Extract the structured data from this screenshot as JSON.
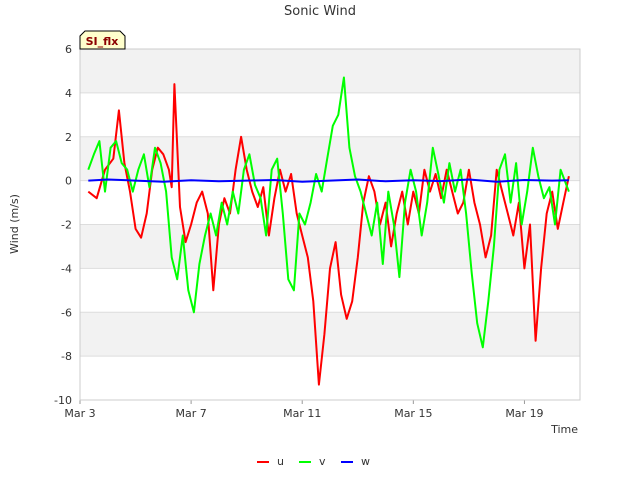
{
  "chart_data": {
    "type": "line",
    "title": "Sonic Wind",
    "xlabel": "Time",
    "ylabel": "Wind (m/s)",
    "badge": "SI_flx",
    "ylim": [
      -10,
      6
    ],
    "yticks": [
      -10,
      -8,
      -6,
      -4,
      -2,
      0,
      2,
      4,
      6
    ],
    "xlim": [
      0,
      18
    ],
    "xticks": [
      {
        "value": 0,
        "label": "Mar 3"
      },
      {
        "value": 4,
        "label": "Mar 7"
      },
      {
        "value": 8,
        "label": "Mar 11"
      },
      {
        "value": 12,
        "label": "Mar 15"
      },
      {
        "value": 16,
        "label": "Mar 19"
      }
    ],
    "grid": true,
    "legend_position": "bottom-center",
    "series": [
      {
        "name": "u",
        "color": "#ff0000",
        "x": [
          0.3,
          0.6,
          0.9,
          1.2,
          1.4,
          1.6,
          1.8,
          2.0,
          2.2,
          2.4,
          2.6,
          2.8,
          3.0,
          3.2,
          3.3,
          3.4,
          3.6,
          3.8,
          4.0,
          4.2,
          4.4,
          4.6,
          4.8,
          5.0,
          5.2,
          5.4,
          5.6,
          5.8,
          6.0,
          6.2,
          6.4,
          6.6,
          6.8,
          7.0,
          7.2,
          7.4,
          7.6,
          7.8,
          8.0,
          8.2,
          8.4,
          8.6,
          8.8,
          9.0,
          9.2,
          9.4,
          9.6,
          9.8,
          10.0,
          10.2,
          10.4,
          10.6,
          10.8,
          11.0,
          11.2,
          11.4,
          11.6,
          11.8,
          12.0,
          12.2,
          12.4,
          12.6,
          12.8,
          13.0,
          13.2,
          13.4,
          13.6,
          13.8,
          14.0,
          14.2,
          14.4,
          14.6,
          14.8,
          15.0,
          15.2,
          15.4,
          15.6,
          15.8,
          16.0,
          16.2,
          16.4,
          16.6,
          16.8,
          17.0,
          17.2,
          17.4,
          17.6
        ],
        "values": [
          -0.5,
          -0.8,
          0.5,
          1.0,
          3.2,
          0.8,
          -0.5,
          -2.2,
          -2.6,
          -1.5,
          0.5,
          1.5,
          1.2,
          0.5,
          -0.3,
          4.4,
          -1.2,
          -2.8,
          -2.0,
          -1.0,
          -0.5,
          -1.5,
          -5.0,
          -2.0,
          -0.8,
          -1.5,
          0.5,
          2.0,
          0.5,
          -0.5,
          -1.2,
          -0.3,
          -2.5,
          -0.8,
          0.5,
          -0.5,
          0.3,
          -1.5,
          -2.5,
          -3.5,
          -5.5,
          -9.3,
          -7.0,
          -4.0,
          -2.8,
          -5.2,
          -6.3,
          -5.5,
          -3.5,
          -1.0,
          0.2,
          -0.5,
          -2.0,
          -1.0,
          -3.0,
          -1.5,
          -0.5,
          -2.0,
          -0.5,
          -1.5,
          0.5,
          -0.5,
          0.3,
          -0.8,
          0.5,
          -0.5,
          -1.5,
          -1.0,
          0.5,
          -1.0,
          -2.0,
          -3.5,
          -2.5,
          0.5,
          -0.5,
          -1.5,
          -2.5,
          -1.0,
          -4.0,
          -2.0,
          -7.3,
          -4.0,
          -1.5,
          -0.5,
          -2.2,
          -1.0,
          0.2
        ]
      },
      {
        "name": "v",
        "color": "#00ff00",
        "x": [
          0.3,
          0.5,
          0.7,
          0.9,
          1.1,
          1.3,
          1.5,
          1.7,
          1.9,
          2.1,
          2.3,
          2.5,
          2.7,
          2.9,
          3.1,
          3.3,
          3.5,
          3.7,
          3.9,
          4.1,
          4.3,
          4.5,
          4.7,
          4.9,
          5.1,
          5.3,
          5.5,
          5.7,
          5.9,
          6.1,
          6.3,
          6.5,
          6.7,
          6.9,
          7.1,
          7.3,
          7.5,
          7.7,
          7.9,
          8.1,
          8.3,
          8.5,
          8.7,
          8.9,
          9.1,
          9.3,
          9.5,
          9.7,
          9.9,
          10.1,
          10.3,
          10.5,
          10.7,
          10.9,
          11.1,
          11.3,
          11.5,
          11.7,
          11.9,
          12.1,
          12.3,
          12.5,
          12.7,
          12.9,
          13.1,
          13.3,
          13.5,
          13.7,
          13.9,
          14.1,
          14.3,
          14.5,
          14.7,
          14.9,
          15.1,
          15.3,
          15.5,
          15.7,
          15.9,
          16.1,
          16.3,
          16.5,
          16.7,
          16.9,
          17.1,
          17.3,
          17.6
        ],
        "values": [
          0.5,
          1.2,
          1.8,
          -0.5,
          1.5,
          1.8,
          0.8,
          0.5,
          -0.5,
          0.5,
          1.2,
          -0.3,
          1.5,
          0.8,
          -0.5,
          -3.5,
          -4.5,
          -2.5,
          -5.0,
          -6.0,
          -3.8,
          -2.5,
          -1.5,
          -2.5,
          -1.0,
          -2.0,
          -0.5,
          -1.5,
          0.5,
          1.2,
          -0.2,
          -0.8,
          -2.5,
          0.5,
          1.0,
          -1.5,
          -4.5,
          -5.0,
          -1.5,
          -2.0,
          -1.0,
          0.3,
          -0.5,
          1.0,
          2.5,
          3.0,
          4.7,
          1.5,
          0.2,
          -0.5,
          -1.5,
          -2.5,
          -1.0,
          -3.8,
          -0.5,
          -2.0,
          -4.4,
          -1.0,
          0.5,
          -0.5,
          -2.5,
          -1.0,
          1.5,
          0.3,
          -1.0,
          0.8,
          -0.5,
          0.5,
          -1.5,
          -4.2,
          -6.5,
          -7.6,
          -5.5,
          -3.0,
          0.5,
          1.2,
          -1.0,
          0.8,
          -2.0,
          -0.5,
          1.5,
          0.2,
          -0.8,
          -0.3,
          -2.0,
          0.5,
          -0.5
        ]
      },
      {
        "name": "w",
        "color": "#0000ff",
        "x": [
          0.3,
          1.0,
          2.0,
          3.0,
          4.0,
          5.0,
          6.0,
          7.0,
          8.0,
          9.0,
          10.0,
          11.0,
          12.0,
          13.0,
          14.0,
          15.0,
          16.0,
          17.0,
          17.6
        ],
        "values": [
          0.0,
          0.05,
          0.0,
          -0.05,
          0.02,
          -0.03,
          0.0,
          0.03,
          -0.05,
          0.0,
          0.05,
          -0.03,
          0.02,
          -0.02,
          0.05,
          -0.05,
          0.03,
          0.0,
          0.02
        ]
      }
    ]
  }
}
